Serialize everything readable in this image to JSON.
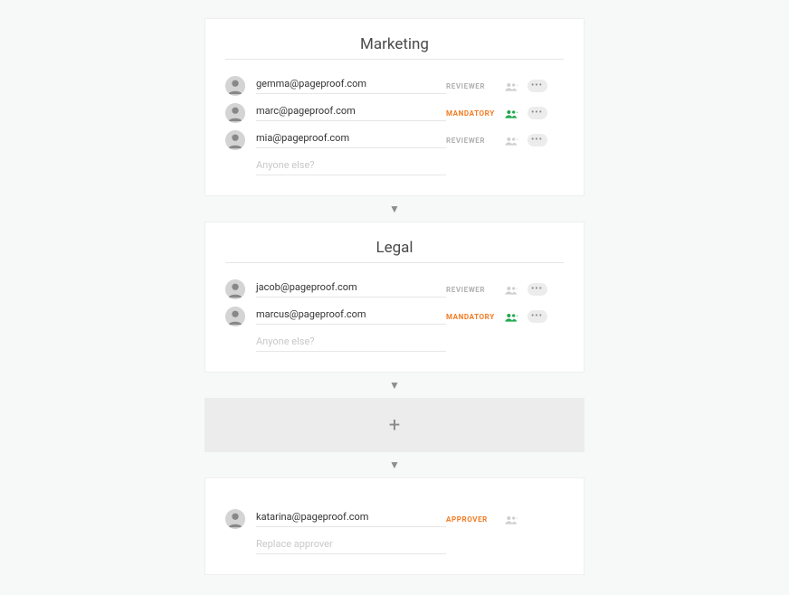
{
  "steps": [
    {
      "title": "Marketing",
      "members": [
        {
          "email": "gemma@pageproof.com",
          "role": "REVIEWER",
          "roleClass": "role-reviewer",
          "groupActive": false
        },
        {
          "email": "marc@pageproof.com",
          "role": "MANDATORY",
          "roleClass": "role-mandatory",
          "groupActive": true
        },
        {
          "email": "mia@pageproof.com",
          "role": "REVIEWER",
          "roleClass": "role-reviewer",
          "groupActive": false
        }
      ],
      "placeholder": "Anyone else?"
    },
    {
      "title": "Legal",
      "members": [
        {
          "email": "jacob@pageproof.com",
          "role": "REVIEWER",
          "roleClass": "role-reviewer",
          "groupActive": false
        },
        {
          "email": "marcus@pageproof.com",
          "role": "MANDATORY",
          "roleClass": "role-mandatory",
          "groupActive": true
        }
      ],
      "placeholder": "Anyone else?"
    }
  ],
  "addStep": {
    "label": "+"
  },
  "approver": {
    "email": "katarina@pageproof.com",
    "role": "APPROVER",
    "placeholder": "Replace approver"
  }
}
